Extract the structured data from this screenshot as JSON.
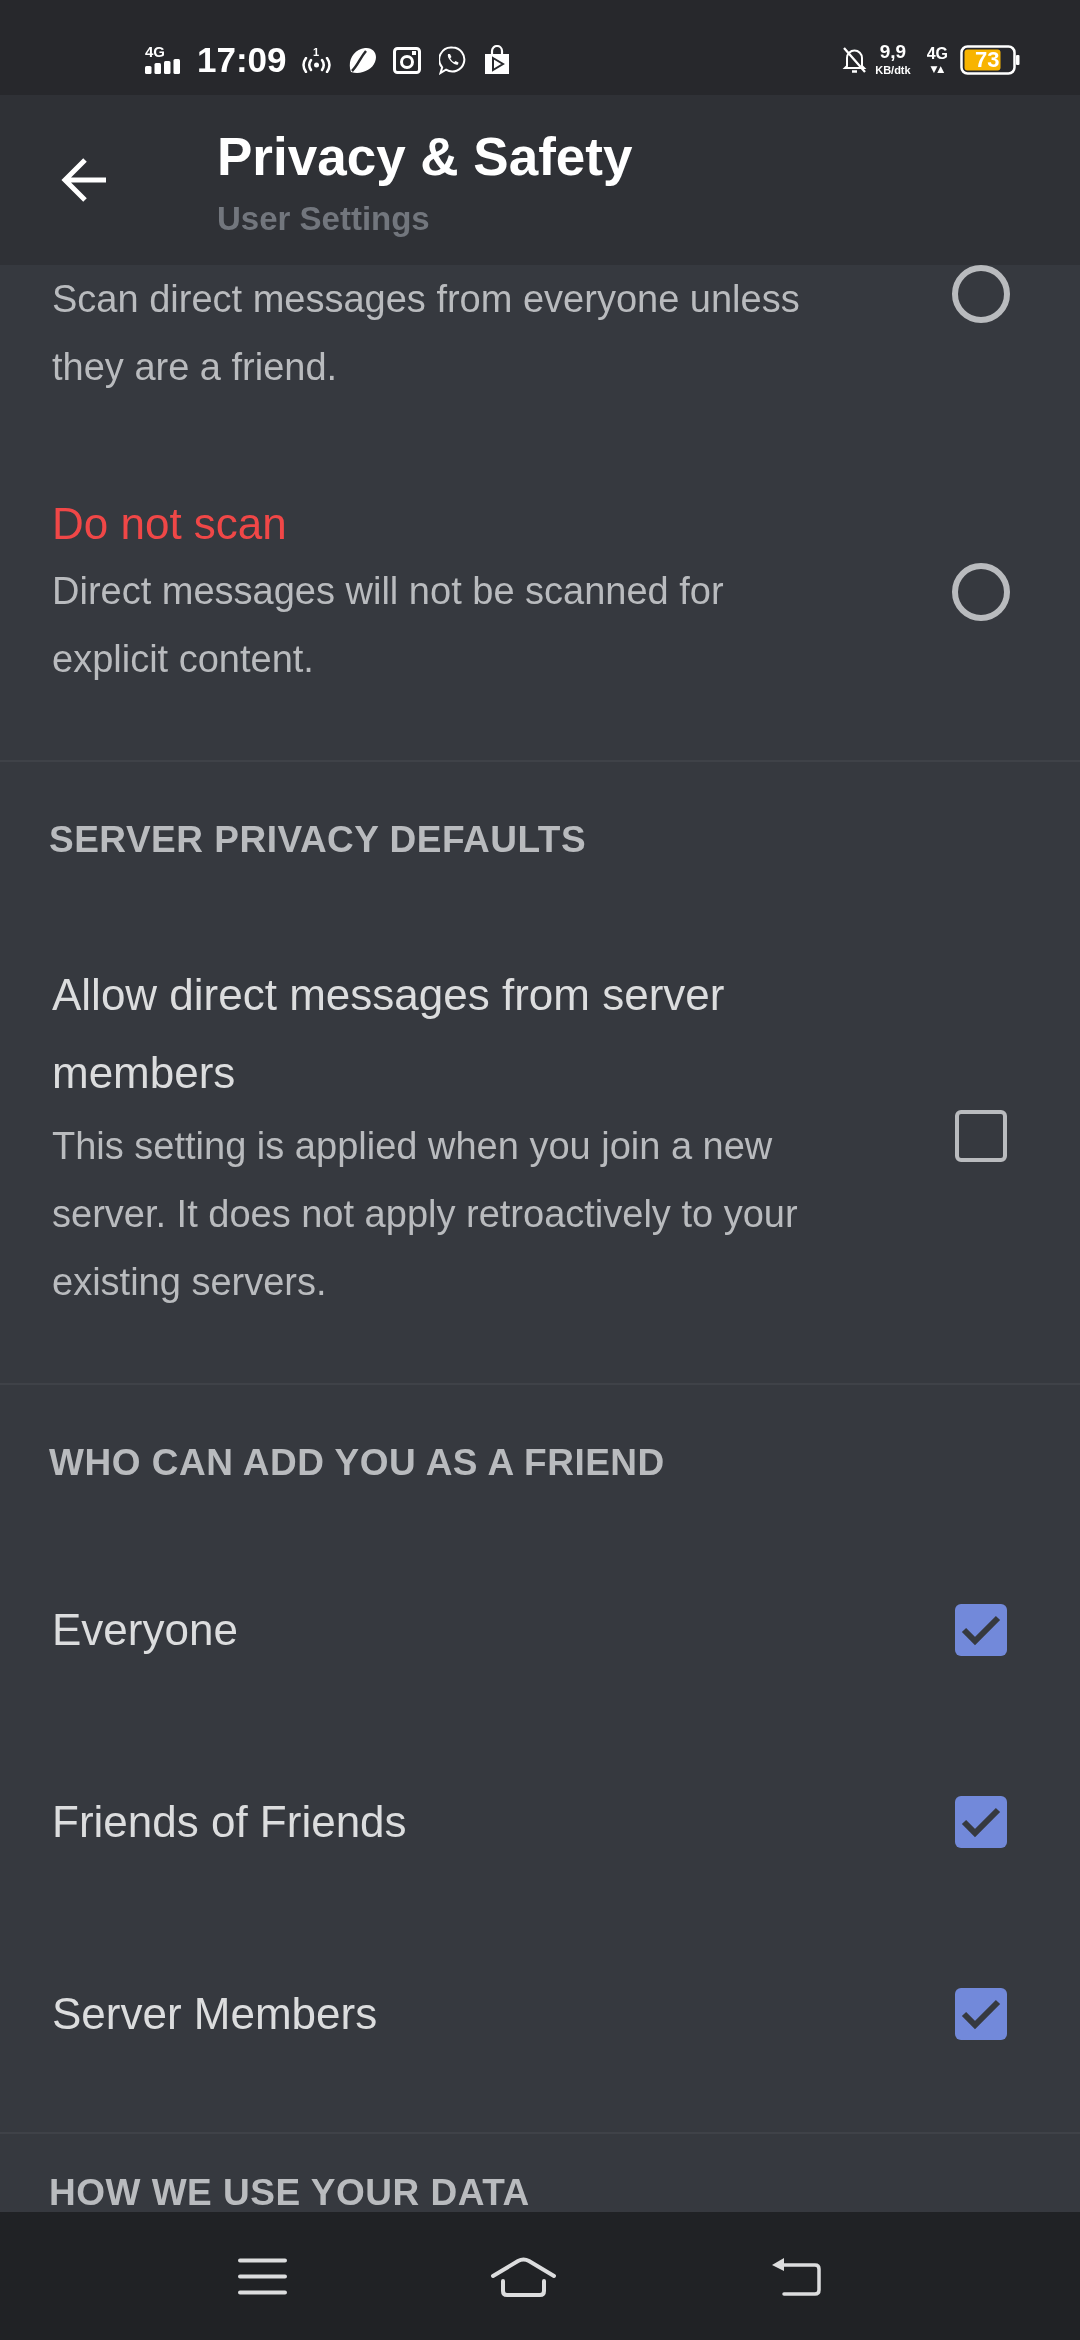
{
  "status_bar": {
    "network_type": "4G",
    "time": "17:09",
    "hotspot_count": "1",
    "speed_value": "9,9",
    "speed_unit": "KB/dtk",
    "data_network": "4G",
    "data_arrows": "▼▲",
    "battery": "73"
  },
  "header": {
    "title": "Privacy & Safety",
    "subtitle": "User Settings"
  },
  "sections": [
    {
      "items": [
        {
          "kind": "radio",
          "description": "Scan direct messages from everyone unless they are a friend.",
          "selected": false
        },
        {
          "kind": "radio",
          "label": "Do not scan",
          "color": "#f04747",
          "description": "Direct messages will not be scanned for explicit content.",
          "selected": false
        }
      ]
    },
    {
      "heading": "SERVER PRIVACY DEFAULTS",
      "items": [
        {
          "kind": "checkbox",
          "label": "Allow direct messages from server members",
          "description": "This setting is applied when you join a new server. It does not apply retroactively to your existing servers.",
          "checked": false
        }
      ]
    },
    {
      "heading": "WHO CAN ADD YOU AS A FRIEND",
      "items": [
        {
          "kind": "checkbox",
          "label": "Everyone",
          "checked": true
        },
        {
          "kind": "checkbox",
          "label": "Friends of Friends",
          "checked": true
        },
        {
          "kind": "checkbox",
          "label": "Server Members",
          "checked": true
        }
      ]
    },
    {
      "heading": "HOW WE USE YOUR DATA"
    }
  ]
}
